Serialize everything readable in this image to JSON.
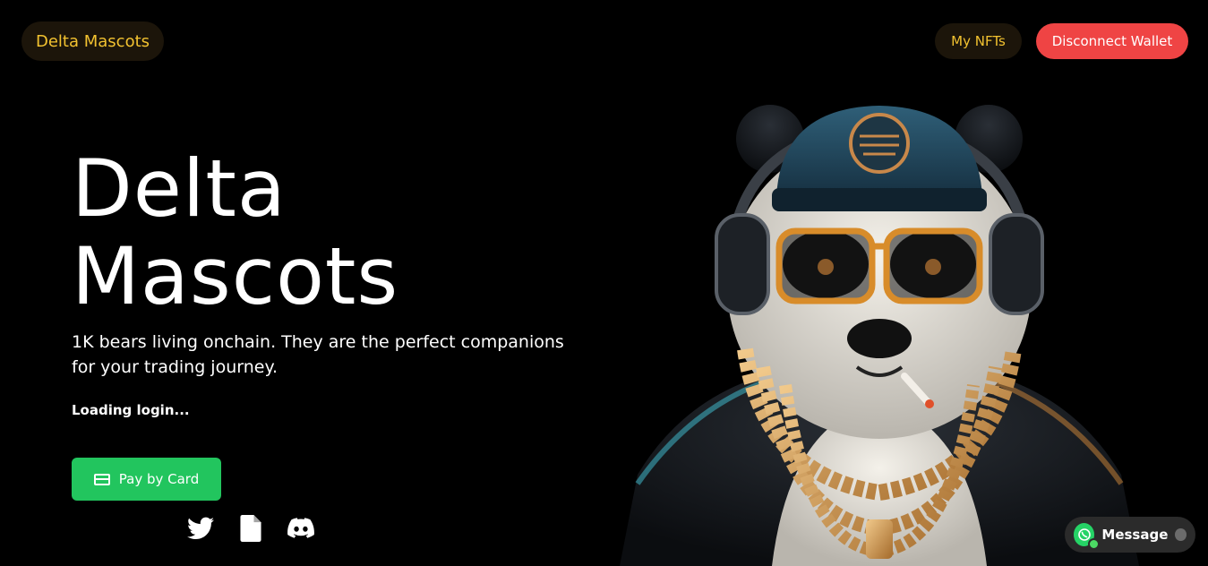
{
  "header": {
    "brand": "Delta Mascots",
    "my_nfts": "My NFTs",
    "disconnect": "Disconnect Wallet"
  },
  "hero": {
    "title_line1": "Delta",
    "title_line2": "Mascots",
    "subtitle": "1K bears living onchain. They are the perfect companions for your trading journey.",
    "status": "Loading login...",
    "pay_button": "Pay by Card"
  },
  "socials": [
    {
      "icon": "twitter-icon"
    },
    {
      "icon": "document-icon"
    },
    {
      "icon": "discord-icon"
    }
  ],
  "message_widget": {
    "label": "Message"
  },
  "colors": {
    "accent_gold": "#f2c230",
    "disconnect_red": "#ef4444",
    "pay_green": "#22c55e",
    "whatsapp_green": "#25d366"
  }
}
